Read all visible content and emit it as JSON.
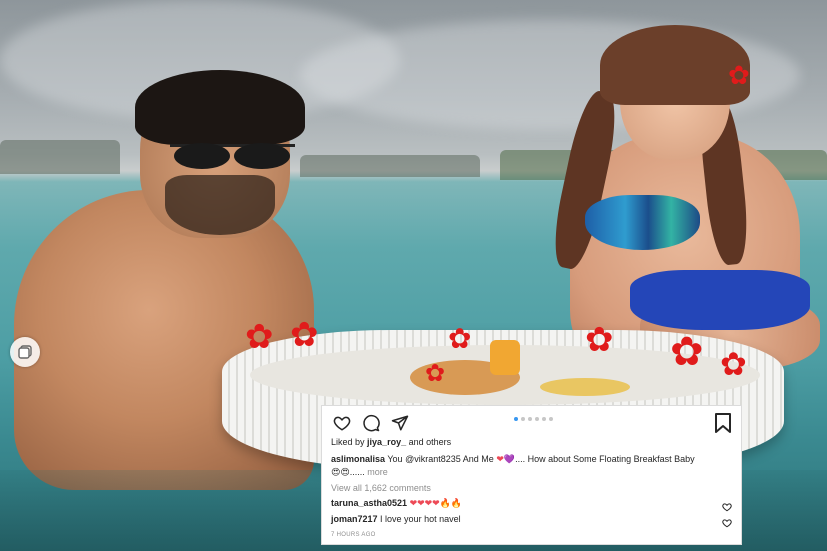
{
  "post": {
    "likes_prefix": "Liked by",
    "liked_by_user": "jiya_roy_",
    "likes_suffix": "and others",
    "caption_user": "aslimonalisa",
    "caption_text_1": "You",
    "caption_mention": "@vikrant8235",
    "caption_text_2": "And Me",
    "caption_emojis_1": "❤💜",
    "caption_text_3": ".... How about Some Floating Breakfast Baby",
    "caption_emojis_2": "😍😍",
    "caption_ellipsis": "......",
    "more_label": "more",
    "view_comments": "View all 1,662 comments",
    "timestamp": "7 HOURS AGO"
  },
  "comments": [
    {
      "user": "taruna_astha0521",
      "text": "❤❤❤❤🔥🔥"
    },
    {
      "user": "joman7217",
      "text": "I love your hot navel"
    }
  ],
  "carousel": {
    "total": 6,
    "active_index": 0
  },
  "icons": [
    "heart-icon",
    "comment-icon",
    "share-icon",
    "bookmark-icon",
    "carousel-indicator-icon"
  ],
  "colors": {
    "accent": "#3897f0",
    "text": "#262626",
    "muted": "#8e8e8e",
    "heart_red": "#ed4956"
  }
}
